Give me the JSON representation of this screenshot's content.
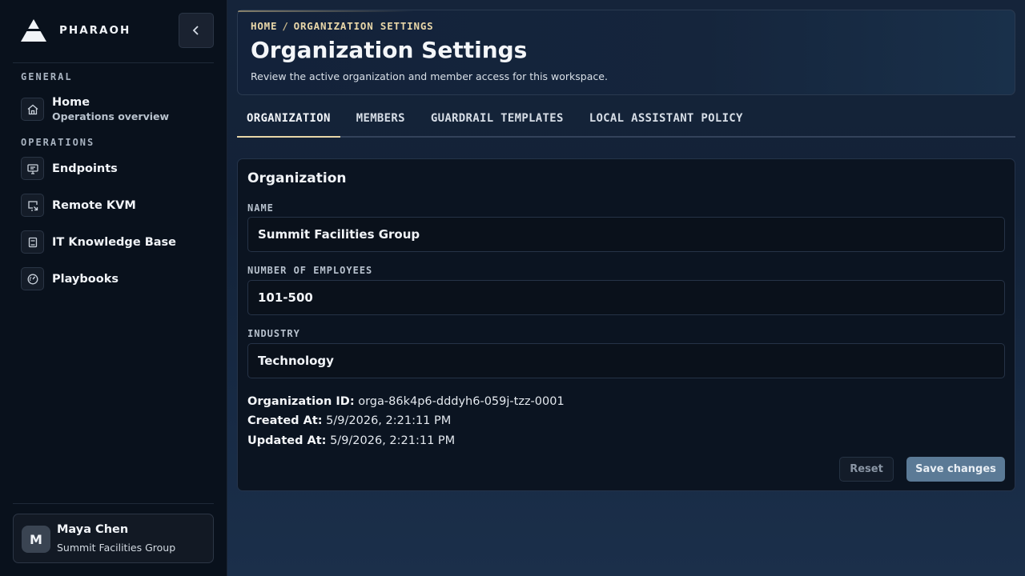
{
  "brand": {
    "name": "PHARAOH"
  },
  "sidebar": {
    "sections": [
      {
        "title": "GENERAL",
        "items": [
          {
            "label": "Home",
            "sub": "Operations overview",
            "icon": "home-icon"
          }
        ]
      },
      {
        "title": "OPERATIONS",
        "items": [
          {
            "label": "Endpoints",
            "icon": "monitor-icon"
          },
          {
            "label": "Remote KVM",
            "icon": "remote-screen-icon"
          },
          {
            "label": "IT Knowledge Base",
            "icon": "book-icon"
          },
          {
            "label": "Playbooks",
            "icon": "gauge-icon"
          }
        ]
      }
    ]
  },
  "user": {
    "initial": "M",
    "name": "Maya Chen",
    "org": "Summit Facilities Group"
  },
  "header": {
    "breadcrumb": [
      "HOME",
      "ORGANIZATION SETTINGS"
    ],
    "breadcrumb_sep": "/",
    "title": "Organization Settings",
    "description": "Review the active organization and member access for this workspace."
  },
  "tabs": [
    {
      "label": "ORGANIZATION",
      "active": true
    },
    {
      "label": "MEMBERS",
      "active": false
    },
    {
      "label": "GUARDRAIL TEMPLATES",
      "active": false
    },
    {
      "label": "LOCAL ASSISTANT POLICY",
      "active": false
    }
  ],
  "panel": {
    "title": "Organization",
    "fields": [
      {
        "label": "NAME",
        "value": "Summit Facilities Group"
      },
      {
        "label": "NUMBER OF EMPLOYEES",
        "value": "101-500"
      },
      {
        "label": "INDUSTRY",
        "value": "Technology"
      }
    ],
    "meta": [
      {
        "key": "Organization ID:",
        "value": "orga-86k4p6-dddyh6-059j-tzz-0001"
      },
      {
        "key": "Created At:",
        "value": "5/9/2026, 2:21:11 PM"
      },
      {
        "key": "Updated At:",
        "value": "5/9/2026, 2:21:11 PM"
      }
    ],
    "reset_label": "Reset",
    "save_label": "Save changes"
  },
  "colors": {
    "accent": "#e8d6a8",
    "primary_button": "#5b7a96",
    "sidebar_bg": "#09111c"
  }
}
